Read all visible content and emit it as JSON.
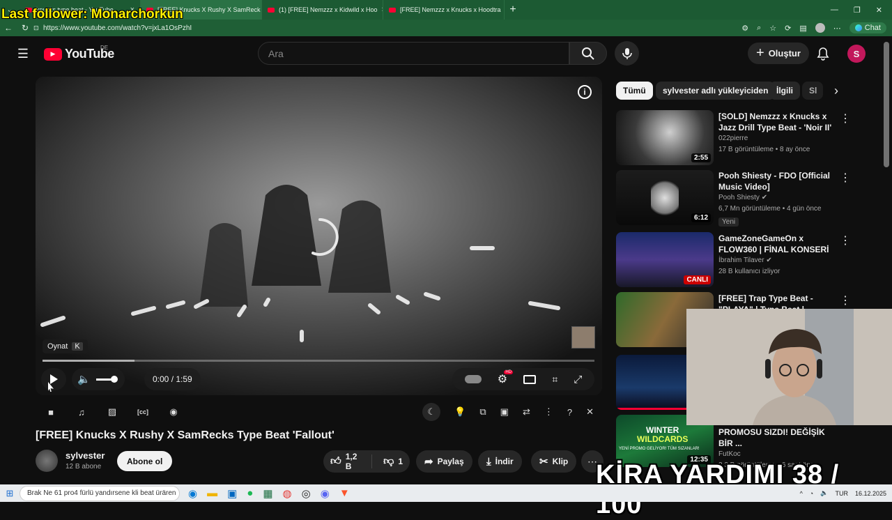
{
  "browser": {
    "tabs": [
      {
        "label": "knucks type beat - YouTube",
        "active": false
      },
      {
        "label": "[FREE] Knucks X Rushy X SamReck",
        "active": true
      },
      {
        "label": "(1) [FREE] Nemzzz x Kidwild x Hoo",
        "active": false
      },
      {
        "label": "[FREE] Nemzzz x Knucks x Hoodtra",
        "active": false
      }
    ],
    "url": "https://www.youtube.com/watch?v=jxLa1OsPzhI",
    "chat_label": "Chat"
  },
  "stream_overlay": {
    "last_follower": "Last follower: Monarchorkun",
    "goal_text": "KİRA YARDIMI 38 / 100"
  },
  "youtube": {
    "logo_text": "YouTube",
    "region": "DE",
    "search_placeholder": "Ara",
    "create_label": "Oluştur",
    "avatar_letter": "S"
  },
  "player": {
    "tooltip_label": "Oynat",
    "tooltip_key": "K",
    "time": "0:00 / 1:59",
    "progress": 0.0
  },
  "video": {
    "title": "[FREE] Knucks X Rushy X SamRecks Type Beat 'Fallout'",
    "channel": "sylvester",
    "subscribers": "12 B abone",
    "subscribe_label": "Abone ol",
    "likes": "1,2 B",
    "dislikes": "1",
    "share_label": "Paylaş",
    "download_label": "İndir",
    "clip_label": "Klip"
  },
  "chips": [
    "Tümü",
    "sylvester adlı yükleyiciden",
    "İlgili",
    "Sl"
  ],
  "recommendations": [
    {
      "title": "[SOLD] Nemzzz x Knucks x Jazz Drill Type Beat - 'Noir II'",
      "channel": "022pierre",
      "meta": "17 B görüntüleme • 8 ay önce",
      "duration": "2:55",
      "verified": false,
      "badge": ""
    },
    {
      "title": "Pooh Shiesty - FDO [Official Music Video]",
      "channel": "Pooh Shiesty",
      "meta": "6,7 Mn görüntüleme • 4 gün önce",
      "duration": "6:12",
      "verified": true,
      "badge": "Yeni"
    },
    {
      "title": "GameZoneGameOn x FLOW360 | FİNAL KONSERİ",
      "channel": "İbrahim Tilaver",
      "meta": "28 B kullanıcı izliyor",
      "duration": "CANLI",
      "verified": true,
      "badge": ""
    },
    {
      "title": "[FREE] Trap Type Beat - \"PLAYA\" | Type Beat | Freestyle Beat |",
      "channel": "",
      "meta": "",
      "duration": "",
      "verified": false,
      "badge": ""
    },
    {
      "title": "",
      "channel": "",
      "meta": "",
      "duration": "",
      "verified": false,
      "badge": ""
    },
    {
      "title": "PROMOSU SIZDI! DEĞİŞİK BİR ...",
      "channel": "FutKoc",
      "meta": "2,3 B görüntüleme • 6 saat önce",
      "duration": "12:35",
      "verified": false,
      "badge": ""
    }
  ],
  "promo_thumb": {
    "line1": "WINTER",
    "line2": "WILDCARDS",
    "line3": "YENİ PROMO GELİYOR! TÜM SIZANLAR!"
  },
  "taskbar": {
    "search_text": "Brak Ne 61 pro4 fürlü yandırsene kli beat ürären",
    "lang": "TUR",
    "date": "16.12.2025"
  }
}
